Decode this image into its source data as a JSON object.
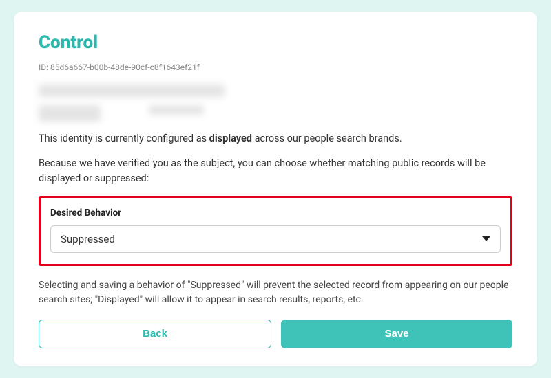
{
  "title": "Control",
  "id_label": "ID:",
  "id_value": "85d6a667-b00b-48de-90cf-c8f1643ef21f",
  "status_text_pre": "This identity is currently configured as ",
  "status_text_bold": "displayed",
  "status_text_post": " across our people search brands.",
  "verified_text": "Because we have verified you as the subject, you can choose whether matching public records will be displayed or suppressed:",
  "behavior": {
    "label": "Desired Behavior",
    "selected": "Suppressed"
  },
  "help_text": "Selecting and saving a behavior of \"Suppressed\" will prevent the selected record from appearing on our people search sites; \"Displayed\" will allow it to appear in search results, reports, etc.",
  "buttons": {
    "back": "Back",
    "save": "Save"
  }
}
